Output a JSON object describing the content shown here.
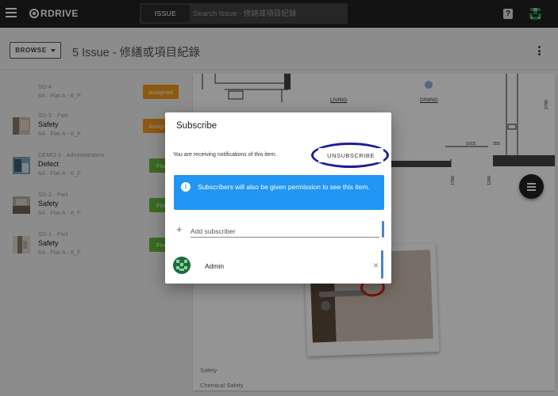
{
  "header": {
    "app_name": "RDRIVE",
    "search_tab": "ISSUE",
    "search_placeholder": "Search Issue - 修繕或項目紀錄",
    "help_label": "?"
  },
  "toolbar": {
    "browse_label": "BROWSE",
    "page_title": "5 Issue - 修繕或項目紀錄"
  },
  "issues": [
    {
      "meta": "SD-4",
      "title": "",
      "location": "6A · Flat A - 6_F",
      "status": "Assigned",
      "status_color": "#f39a1a",
      "has_thumb": false
    },
    {
      "meta": "SD-3 · Part",
      "title": "Safety",
      "location": "6A · Flat A - 6_F",
      "status": "Assigned",
      "status_color": "#f39a1a",
      "has_thumb": true
    },
    {
      "meta": "DEMO-1 · Administrators",
      "title": "Defect",
      "location": "6A · Flat A - 6_F",
      "status": "Fixed",
      "status_color": "#64ba3a",
      "has_thumb": true
    },
    {
      "meta": "SD-2 · Part",
      "title": "Safety",
      "location": "6A · Flat A - 6_F",
      "status": "Fixed",
      "status_color": "#64ba3a",
      "has_thumb": true
    },
    {
      "meta": "SD-1 · Part",
      "title": "Safety",
      "location": "6A · Flat A - 6_F",
      "status": "Fixed",
      "status_color": "#64ba3a",
      "has_thumb": true
    }
  ],
  "preview": {
    "plan_labels": [
      "LIVING",
      "DINING"
    ],
    "plan_dims": [
      "1015",
      "355",
      "2780",
      "1700",
      "1200"
    ],
    "category": "Safety",
    "subcategory": "Chemical Safety"
  },
  "dialog": {
    "title": "Subscribe",
    "status_text": "You are receiving notifications of this item.",
    "unsubscribe_label": "UNSUBSCRIBE",
    "info_icon": "i",
    "info_text": "Subscribers will also be given permission to see this item.",
    "add_plus": "+",
    "add_placeholder": "Add subscriber",
    "subscriber_name": "Admin",
    "remove_glyph": "×"
  },
  "colors": {
    "topbar": "#212121",
    "info_blue": "#2196f3",
    "assigned": "#f39a1a",
    "fixed": "#64ba3a",
    "avatar_green": "#2e8b57",
    "highlight_ring": "#1b1d96"
  }
}
